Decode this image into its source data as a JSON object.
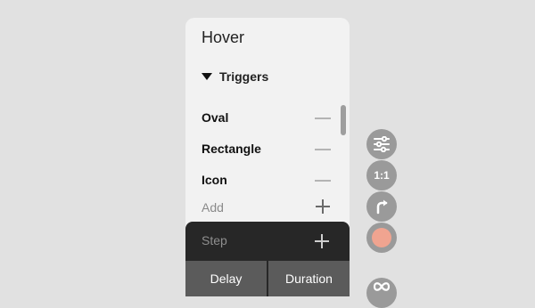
{
  "panel": {
    "title": "Hover",
    "section_label": "Triggers",
    "triggers": [
      {
        "label": "Oval"
      },
      {
        "label": "Rectangle"
      },
      {
        "label": "Icon"
      }
    ],
    "add_label": "Add",
    "step_label": "Step",
    "tabs": [
      {
        "label": "Delay"
      },
      {
        "label": "Duration"
      }
    ]
  },
  "toolbar": {
    "items": [
      {
        "icon": "sliders-icon"
      },
      {
        "icon": "aspect-ratio-icon",
        "text": "1:1"
      },
      {
        "icon": "rotate-icon"
      },
      {
        "icon": "color-swatch-icon",
        "color": "#f0a490"
      },
      {
        "icon": "infinity-icon"
      }
    ]
  },
  "colors": {
    "background": "#e1e1e1",
    "panel": "#f2f2f2",
    "dark_bar": "#272727",
    "tab": "#5b5b5b",
    "tool_button": "#9a9a9a",
    "swatch": "#f0a490"
  }
}
